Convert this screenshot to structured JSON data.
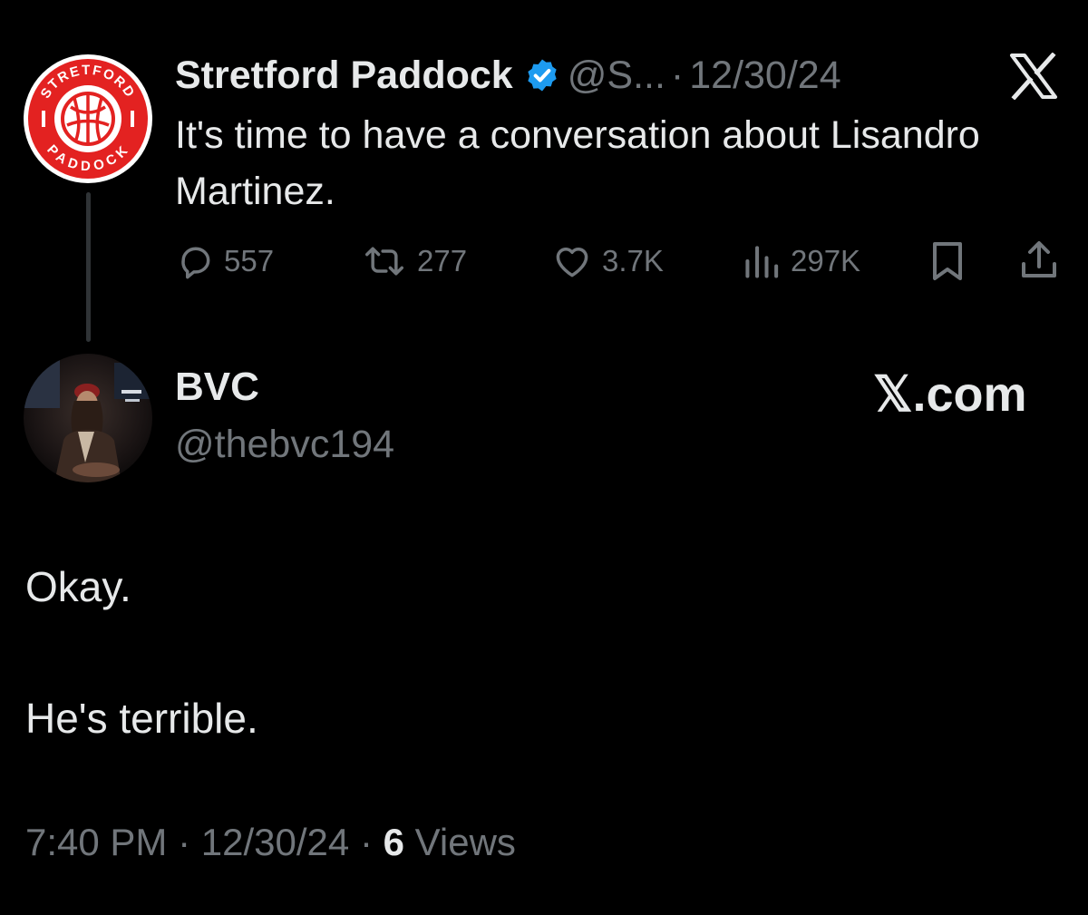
{
  "quoted_tweet": {
    "display_name": "Stretford Paddock",
    "handle": "@S...",
    "separator": "·",
    "date": "12/30/24",
    "text": "It's time to have a conversation about Lisandro Martinez.",
    "avatar_logo_text": "STRETFORD PADDOCK",
    "stats": {
      "replies": "557",
      "reposts": "277",
      "likes": "3.7K",
      "views": "297K"
    },
    "icons": {
      "verified": "verified-badge-icon",
      "brand": "x-logo-icon",
      "reply": "reply-icon",
      "repost": "repost-icon",
      "like": "heart-icon",
      "views": "views-bar-icon",
      "bookmark": "bookmark-icon",
      "share": "share-icon"
    }
  },
  "reply": {
    "display_name": "BVC",
    "handle": "@thebvc194",
    "watermark": "𝕏.com",
    "lines": [
      "Okay.",
      "He's terrible."
    ]
  },
  "footer": {
    "time": "7:40 PM",
    "separator": "·",
    "date": "12/30/24",
    "views_count": "6",
    "views_label": "Views"
  },
  "colors": {
    "background": "#000000",
    "text_primary": "#e7e9ea",
    "text_secondary": "#71767b",
    "verified_blue": "#1d9bf0",
    "logo_red": "#e32221"
  }
}
